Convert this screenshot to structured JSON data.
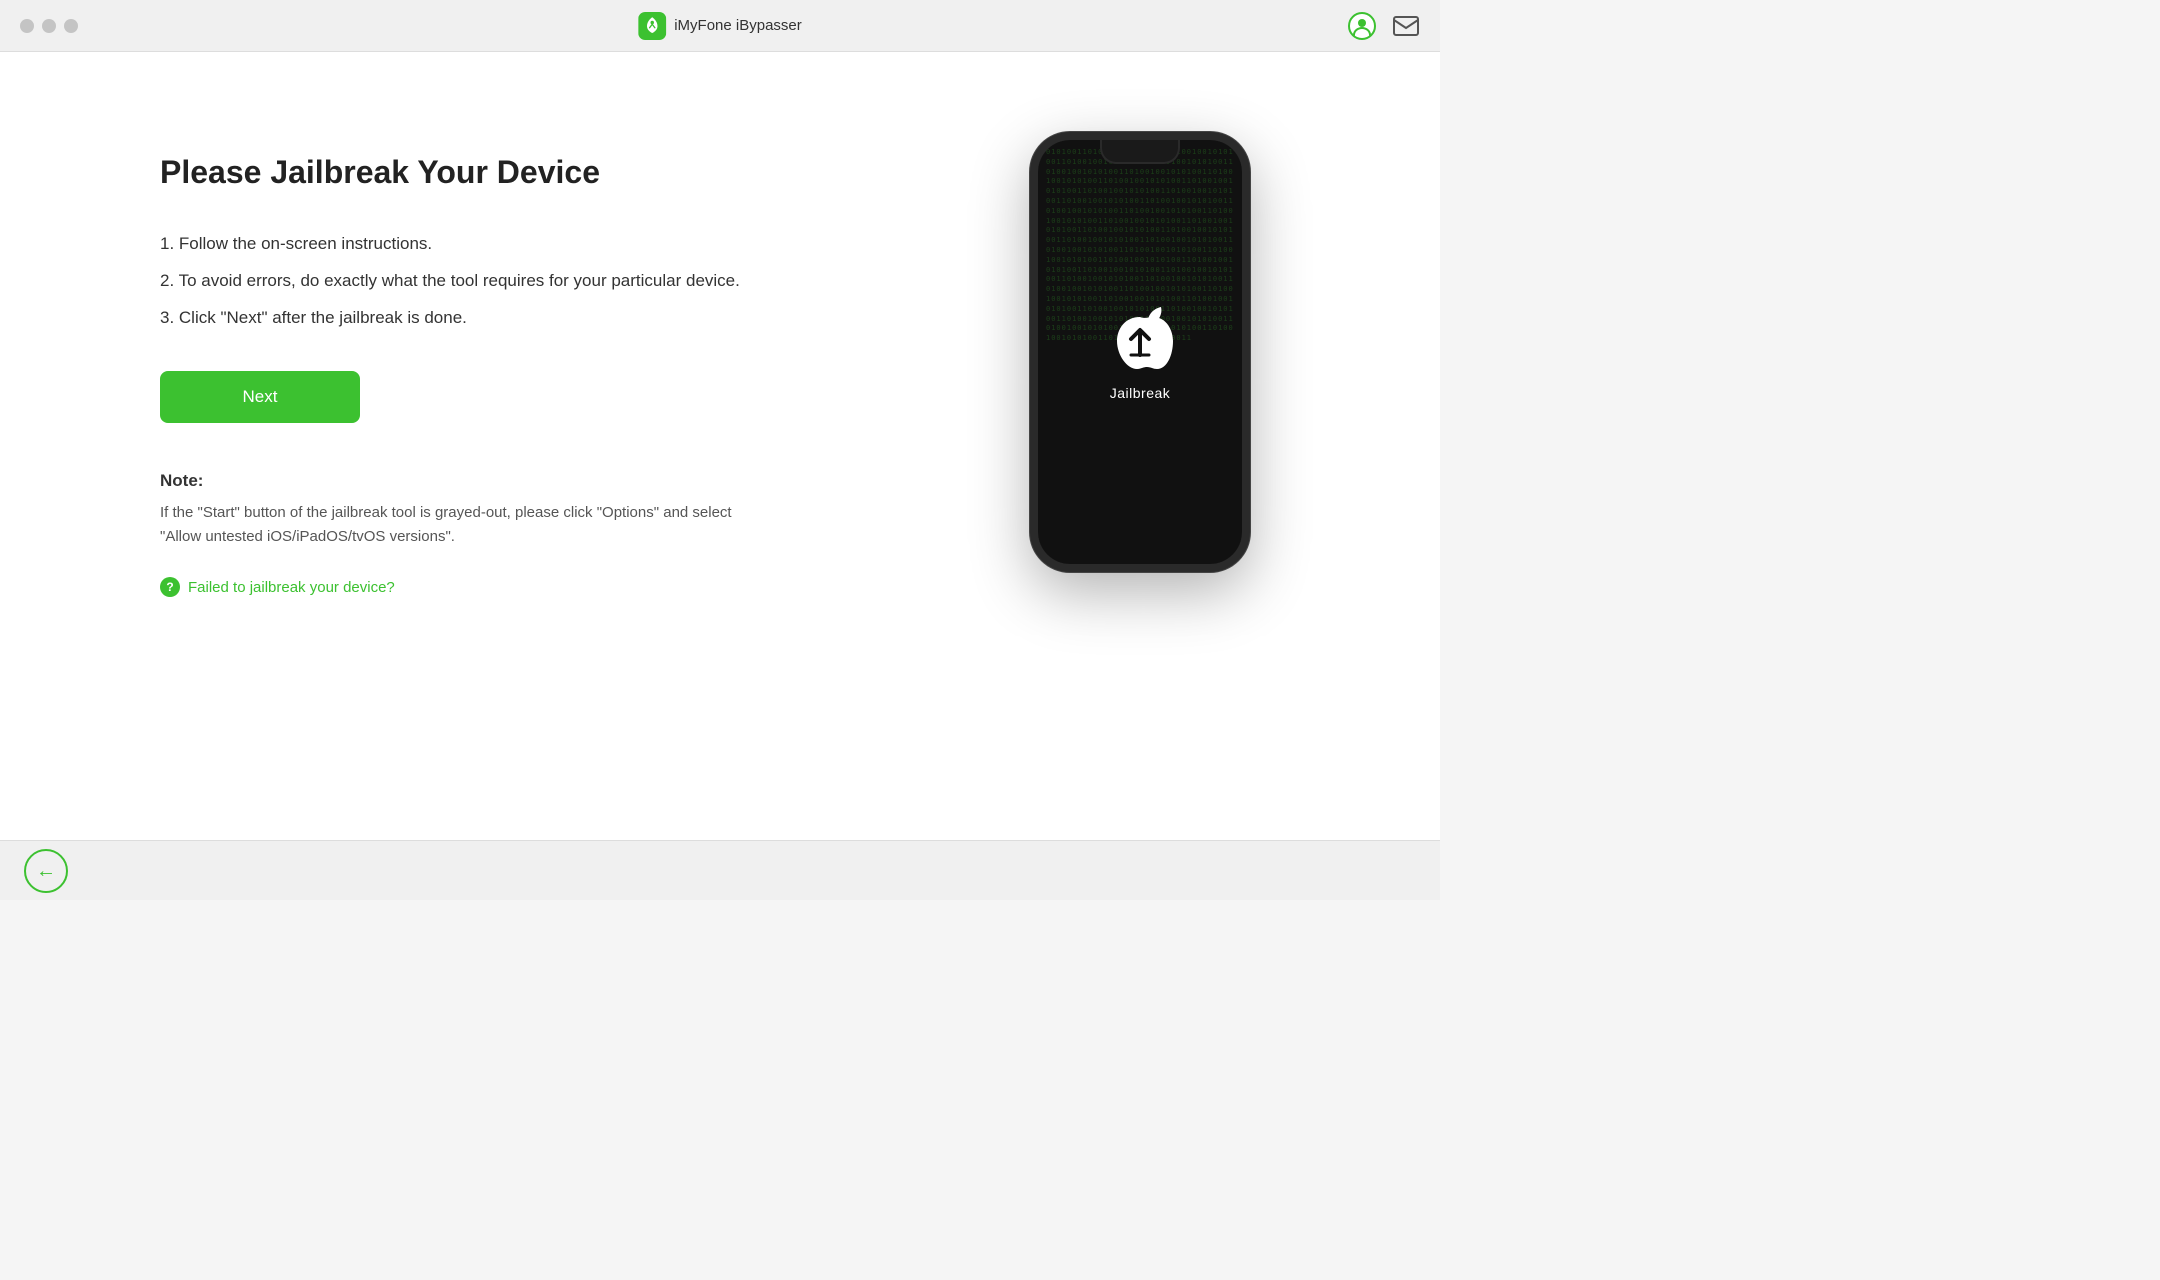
{
  "app": {
    "title": "iMyFone iBypasser",
    "logo_color": "#3cc130"
  },
  "titlebar": {
    "traffic_lights": [
      "close",
      "minimize",
      "maximize"
    ]
  },
  "page": {
    "heading": "Please Jailbreak Your Device",
    "instructions": [
      "1. Follow the on-screen instructions.",
      "2. To avoid errors, do exactly what the tool requires for your particular device.",
      "3. Click \"Next\" after the jailbreak is done."
    ],
    "next_button_label": "Next",
    "note_title": "Note:",
    "note_text": "If the \"Start\" button of the jailbreak tool is grayed-out, please click \"Options\" and select \"Allow untested iOS/iPadOS/tvOS versions\".",
    "failed_link_text": "Failed to jailbreak your device?",
    "jailbreak_label": "Jailbreak"
  },
  "phone": {
    "matrix_chars": "01001011010010110100101101001011010010110100101101001011010010110100101101001011010010110100101101001011010010110100101101001011010010110100101101001011010010110100101101001011010010110100101101001011010010110100101101001011010010110100101101001011010010110100101101001011010010110100101101001011010010110100101101001011010010110100101101001011010010110100101101001011010010110100101101001011010010110100101101001011010010110100101101001011"
  },
  "colors": {
    "accent_green": "#3cc130",
    "text_primary": "#222222",
    "text_secondary": "#555555",
    "background": "#ffffff",
    "titlebar_bg": "#f0f0f0",
    "phone_body": "#1a1a1a"
  }
}
